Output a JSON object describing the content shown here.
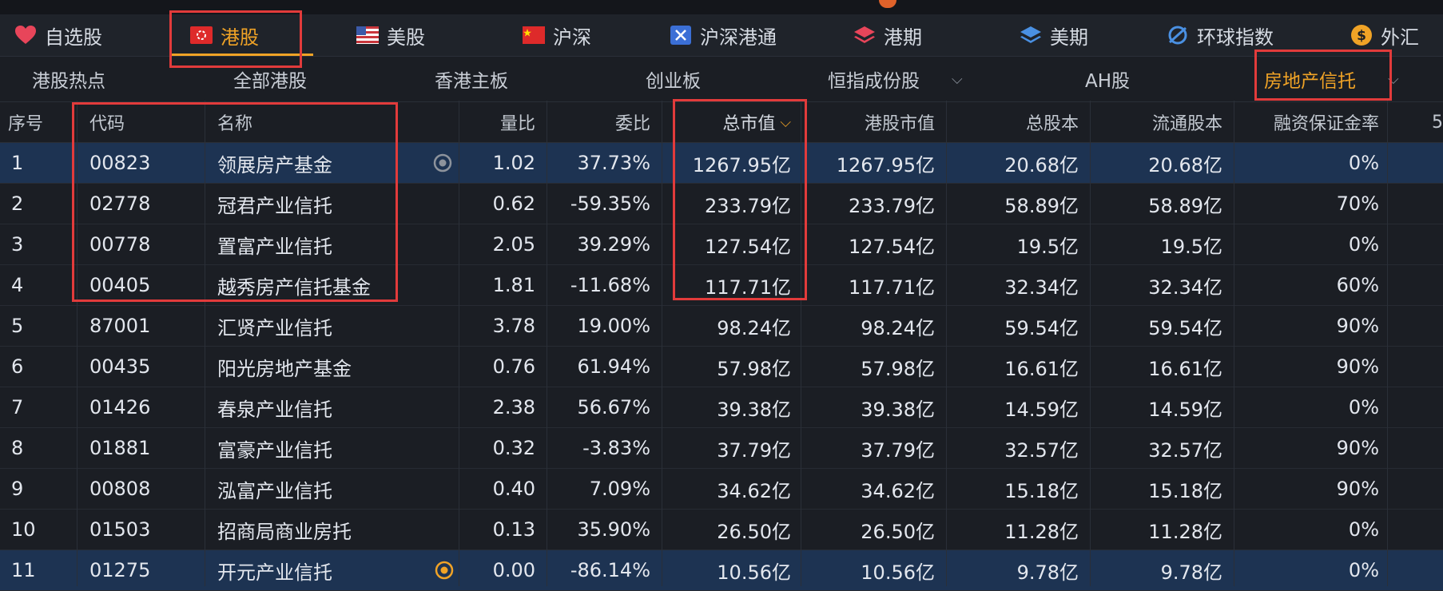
{
  "market_tabs": [
    {
      "label": "自选股",
      "icon": "heart-icon",
      "active": false
    },
    {
      "label": "港股",
      "icon": "hk-flag-icon",
      "active": true
    },
    {
      "label": "美股",
      "icon": "us-flag-icon",
      "active": false
    },
    {
      "label": "沪深",
      "icon": "cn-flag-icon",
      "active": false
    },
    {
      "label": "沪深港通",
      "icon": "connect-icon",
      "active": false
    },
    {
      "label": "港期",
      "icon": "layers-red-icon",
      "active": false
    },
    {
      "label": "美期",
      "icon": "layers-blue-icon",
      "active": false
    },
    {
      "label": "环球指数",
      "icon": "globe-icon",
      "active": false
    },
    {
      "label": "外汇",
      "icon": "dollar-coin-icon",
      "active": false
    }
  ],
  "sub_tabs": [
    {
      "label": "港股热点"
    },
    {
      "label": "全部港股"
    },
    {
      "label": "香港主板"
    },
    {
      "label": "创业板"
    },
    {
      "label": "恒指成份股"
    },
    {
      "label": "AH股"
    },
    {
      "label": "房地产信托"
    }
  ],
  "table": {
    "headers": [
      "序号",
      "代码",
      "名称",
      "量比",
      "委比",
      "总市值",
      "港股市值",
      "总股本",
      "流通股本",
      "融资保证金率",
      "5"
    ],
    "rows": [
      {
        "idx": "1",
        "code": "00823",
        "name": "领展房产基金",
        "vol": "1.02",
        "bid": "37.73%",
        "mcap": "1267.95亿",
        "hkmcap": "1267.95亿",
        "shares": "20.68亿",
        "float": "20.68亿",
        "margin": "0%",
        "selected": true,
        "icon": "eye-icon"
      },
      {
        "idx": "2",
        "code": "02778",
        "name": "冠君产业信托",
        "vol": "0.62",
        "bid": "-59.35%",
        "mcap": "233.79亿",
        "hkmcap": "233.79亿",
        "shares": "58.89亿",
        "float": "58.89亿",
        "margin": "70%"
      },
      {
        "idx": "3",
        "code": "00778",
        "name": "置富产业信托",
        "vol": "2.05",
        "bid": "39.29%",
        "mcap": "127.54亿",
        "hkmcap": "127.54亿",
        "shares": "19.5亿",
        "float": "19.5亿",
        "margin": "0%"
      },
      {
        "idx": "4",
        "code": "00405",
        "name": "越秀房产信托基金",
        "vol": "1.81",
        "bid": "-11.68%",
        "mcap": "117.71亿",
        "hkmcap": "117.71亿",
        "shares": "32.34亿",
        "float": "32.34亿",
        "margin": "60%"
      },
      {
        "idx": "5",
        "code": "87001",
        "name": "汇贤产业信托",
        "vol": "3.78",
        "bid": "19.00%",
        "mcap": "98.24亿",
        "hkmcap": "98.24亿",
        "shares": "59.54亿",
        "float": "59.54亿",
        "margin": "90%"
      },
      {
        "idx": "6",
        "code": "00435",
        "name": "阳光房地产基金",
        "vol": "0.76",
        "bid": "61.94%",
        "mcap": "57.98亿",
        "hkmcap": "57.98亿",
        "shares": "16.61亿",
        "float": "16.61亿",
        "margin": "90%"
      },
      {
        "idx": "7",
        "code": "01426",
        "name": "春泉产业信托",
        "vol": "2.38",
        "bid": "56.67%",
        "mcap": "39.38亿",
        "hkmcap": "39.38亿",
        "shares": "14.59亿",
        "float": "14.59亿",
        "margin": "0%"
      },
      {
        "idx": "8",
        "code": "01881",
        "name": "富豪产业信托",
        "vol": "0.32",
        "bid": "-3.83%",
        "mcap": "37.79亿",
        "hkmcap": "37.79亿",
        "shares": "32.57亿",
        "float": "32.57亿",
        "margin": "90%"
      },
      {
        "idx": "9",
        "code": "00808",
        "name": "泓富产业信托",
        "vol": "0.40",
        "bid": "7.09%",
        "mcap": "34.62亿",
        "hkmcap": "34.62亿",
        "shares": "15.18亿",
        "float": "15.18亿",
        "margin": "90%"
      },
      {
        "idx": "10",
        "code": "01503",
        "name": "招商局商业房托",
        "vol": "0.13",
        "bid": "35.90%",
        "mcap": "26.50亿",
        "hkmcap": "26.50亿",
        "shares": "11.28亿",
        "float": "11.28亿",
        "margin": "0%"
      },
      {
        "idx": "11",
        "code": "01275",
        "name": "开元产业信托",
        "vol": "0.00",
        "bid": "-86.14%",
        "mcap": "10.56亿",
        "hkmcap": "10.56亿",
        "shares": "9.78亿",
        "float": "9.78亿",
        "margin": "0%",
        "selected": true,
        "icon": "eye-active-icon"
      }
    ]
  },
  "colors": {
    "accent": "#f0a326",
    "highlight_box": "#e23b3b",
    "row_selected": "#1d3352"
  }
}
